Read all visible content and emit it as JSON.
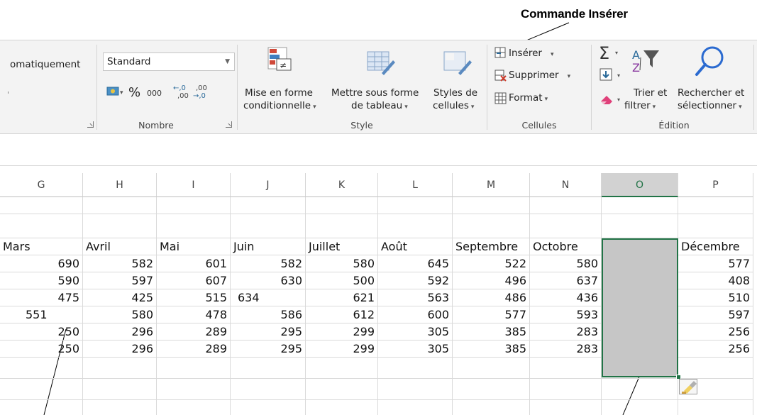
{
  "callout": {
    "title": "Commande Insérer"
  },
  "ribbon": {
    "alignment_partial": "omatiquement",
    "number": {
      "format_value": "Standard",
      "percent": "%",
      "thousands": "000",
      "inc_decimal": "←,0 ,00",
      "dec_decimal": ",00 →,0",
      "group_label": "Nombre"
    },
    "style": {
      "conditional_line1": "Mise en forme",
      "conditional_line2": "conditionnelle",
      "table_line1": "Mettre sous forme",
      "table_line2": "de tableau",
      "cellstyles_line1": "Styles de",
      "cellstyles_line2": "cellules",
      "group_label": "Style"
    },
    "cells": {
      "insert": "Insérer",
      "delete": "Supprimer",
      "format": "Format",
      "group_label": "Cellules"
    },
    "editing": {
      "sort_line1": "Trier et",
      "sort_line2": "filtrer",
      "find_line1": "Rechercher et",
      "find_line2": "sélectionner",
      "group_label": "Édition"
    }
  },
  "grid": {
    "columns": [
      "G",
      "H",
      "I",
      "J",
      "K",
      "L",
      "M",
      "N",
      "O",
      "P"
    ],
    "selected_column": "O",
    "headers": [
      "Mars",
      "Avril",
      "Mai",
      "Juin",
      "Juillet",
      "Août",
      "Septembre",
      "Octobre",
      "",
      "Décembre"
    ],
    "rows": [
      [
        "690",
        "582",
        "601",
        "582",
        "580",
        "645",
        "522",
        "580",
        "",
        "577"
      ],
      [
        "590",
        "597",
        "607",
        "630",
        "500",
        "592",
        "496",
        "637",
        "",
        "408"
      ],
      [
        "475",
        "425",
        "515",
        "634",
        "621",
        "563",
        "486",
        "436",
        "",
        "510"
      ],
      [
        "551",
        "580",
        "478",
        "586",
        "612",
        "600",
        "577",
        "593",
        "",
        "597"
      ],
      [
        "250",
        "296",
        "289",
        "295",
        "299",
        "305",
        "385",
        "283",
        "",
        "256"
      ],
      [
        "250",
        "296",
        "289",
        "295",
        "299",
        "305",
        "385",
        "283",
        "",
        "256"
      ]
    ]
  }
}
